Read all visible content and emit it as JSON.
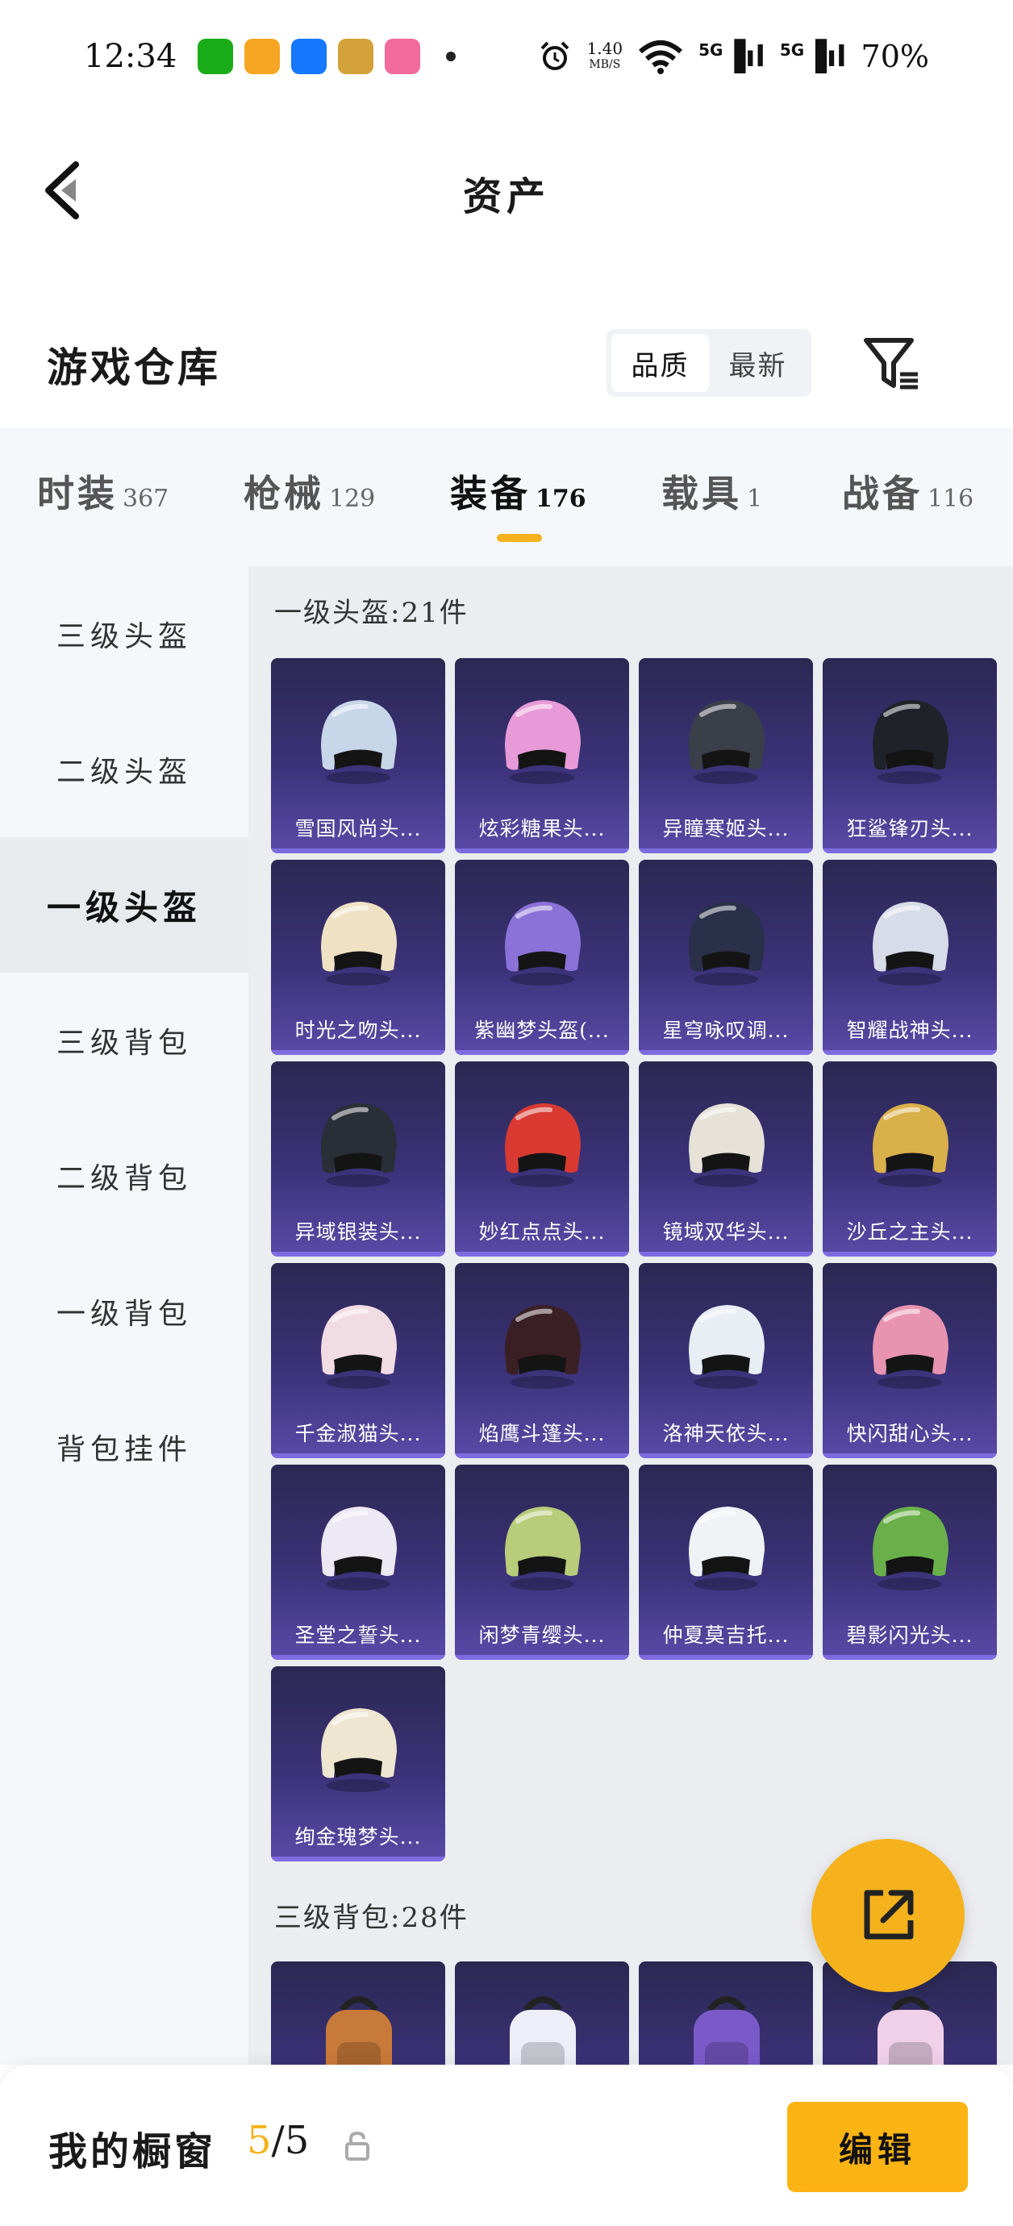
{
  "status_bar": {
    "time": "12:34",
    "speed_value": "1.40",
    "speed_unit": "MB/S",
    "network1": "5G",
    "network2": "5G",
    "battery": "70%"
  },
  "nav": {
    "title": "资产"
  },
  "warehouse": {
    "title": "游戏仓库",
    "sort_quality": "品质",
    "sort_latest": "最新"
  },
  "categories": [
    {
      "label": "时装",
      "count": "367"
    },
    {
      "label": "枪械",
      "count": "129"
    },
    {
      "label": "装备",
      "count": "176"
    },
    {
      "label": "载具",
      "count": "1"
    },
    {
      "label": "战备",
      "count": "116"
    }
  ],
  "sidebar": {
    "items": [
      "三级头盔",
      "二级头盔",
      "一级头盔",
      "三级背包",
      "二级背包",
      "一级背包",
      "背包挂件"
    ]
  },
  "sections": {
    "helmets_title": "一级头盔:21件",
    "bags_title": "三级背包:28件"
  },
  "helmets": [
    {
      "name": "雪国风尚头...",
      "color": "#c8d6ea"
    },
    {
      "name": "炫彩糖果头...",
      "color": "#e89ad8"
    },
    {
      "name": "异瞳寒姬头...",
      "color": "#3b3f4a"
    },
    {
      "name": "狂鲨锋刃头...",
      "color": "#1f2228"
    },
    {
      "name": "时光之吻头...",
      "color": "#efe2c4"
    },
    {
      "name": "紫幽梦头盔(...",
      "color": "#8a72d8"
    },
    {
      "name": "星穹咏叹调...",
      "color": "#2a2f4a"
    },
    {
      "name": "智耀战神头...",
      "color": "#d8dce8"
    },
    {
      "name": "异域银装头...",
      "color": "#2a2e36"
    },
    {
      "name": "妙红点点头...",
      "color": "#d83a32"
    },
    {
      "name": "镜域双华头...",
      "color": "#e6e2d8"
    },
    {
      "name": "沙丘之主头...",
      "color": "#d9b04a"
    },
    {
      "name": "千金淑猫头...",
      "color": "#f2dce4"
    },
    {
      "name": "焰鹰斗篷头...",
      "color": "#3a1f24"
    },
    {
      "name": "洛神天依头...",
      "color": "#e8eef4"
    },
    {
      "name": "快闪甜心头...",
      "color": "#e894b0"
    },
    {
      "name": "圣堂之誓头...",
      "color": "#ece8f4"
    },
    {
      "name": "闲梦青缨头...",
      "color": "#b8cc7a"
    },
    {
      "name": "仲夏莫吉托...",
      "color": "#f0f2f6"
    },
    {
      "name": "碧影闪光头...",
      "color": "#6ab04a"
    },
    {
      "name": "绚金瑰梦头...",
      "color": "#efe6d2"
    }
  ],
  "bags": [
    {
      "color": "#c87a3a"
    },
    {
      "color": "#eeeef8"
    },
    {
      "color": "#7a5ac8"
    },
    {
      "color": "#f0d0e8"
    }
  ],
  "showcase": {
    "label": "我的橱窗",
    "current": "5",
    "total": "/5",
    "edit": "编辑"
  },
  "theme": {
    "accent": "#f5b21c",
    "card_top": "#2b2852",
    "card_bottom": "#5a4aa8"
  }
}
